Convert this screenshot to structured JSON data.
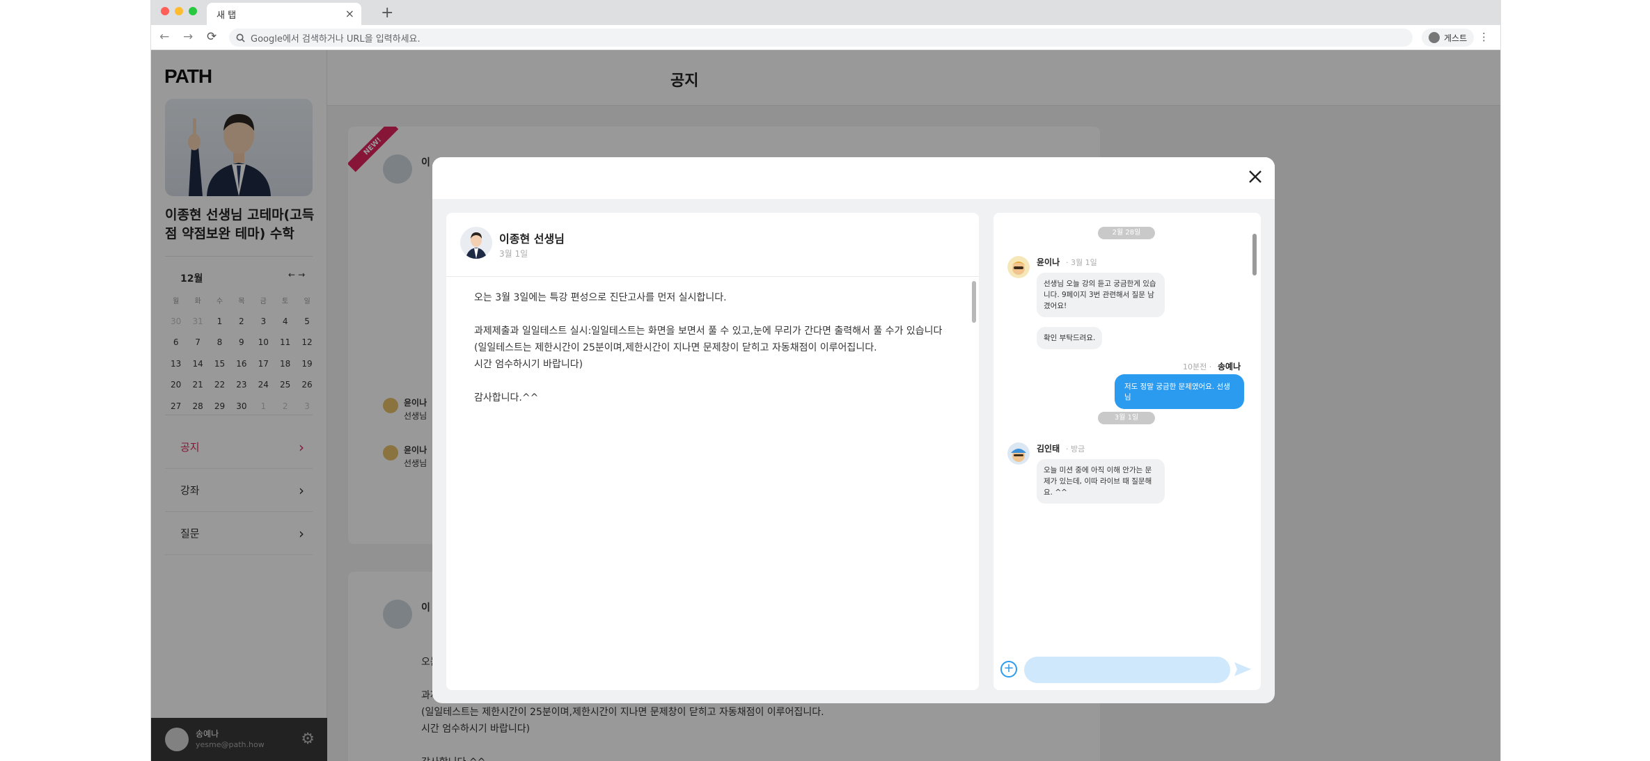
{
  "browser": {
    "tab_title": "새 탭",
    "tab_close": "×",
    "new_tab": "+",
    "omnibox_placeholder": "Google에서 검색하거나 URL을 입력하세요.",
    "profile_label": "게스트",
    "colors": {
      "red": "#ff5f57",
      "yellow": "#febc2e",
      "green": "#28c840"
    }
  },
  "sidebar": {
    "logo": "PATH",
    "course_title": "이종현 선생님 고테마(고득점 약점보완 테마) 수학",
    "calendar": {
      "month": "12월",
      "prev": "←",
      "next": "→",
      "weekdays": [
        "월",
        "화",
        "수",
        "목",
        "금",
        "토",
        "일"
      ],
      "weeks": [
        [
          {
            "d": "30",
            "dim": true
          },
          {
            "d": "31",
            "dim": true
          },
          {
            "d": "1"
          },
          {
            "d": "2"
          },
          {
            "d": "3"
          },
          {
            "d": "4"
          },
          {
            "d": "5"
          }
        ],
        [
          {
            "d": "6"
          },
          {
            "d": "7"
          },
          {
            "d": "8"
          },
          {
            "d": "9"
          },
          {
            "d": "10"
          },
          {
            "d": "11"
          },
          {
            "d": "12"
          }
        ],
        [
          {
            "d": "13"
          },
          {
            "d": "14"
          },
          {
            "d": "15"
          },
          {
            "d": "16"
          },
          {
            "d": "17"
          },
          {
            "d": "18"
          },
          {
            "d": "19"
          }
        ],
        [
          {
            "d": "20"
          },
          {
            "d": "21"
          },
          {
            "d": "22"
          },
          {
            "d": "23"
          },
          {
            "d": "24"
          },
          {
            "d": "25"
          },
          {
            "d": "26"
          }
        ],
        [
          {
            "d": "27"
          },
          {
            "d": "28"
          },
          {
            "d": "29"
          },
          {
            "d": "30"
          },
          {
            "d": "1",
            "dim": true
          },
          {
            "d": "2",
            "dim": true
          },
          {
            "d": "3",
            "dim": true
          }
        ]
      ]
    },
    "menu": [
      {
        "label": "공지",
        "active": true
      },
      {
        "label": "강좌",
        "active": false
      },
      {
        "label": "질문",
        "active": false
      }
    ],
    "user": {
      "name": "송예나",
      "email": "yesme@path.how"
    }
  },
  "main": {
    "page_title": "공지",
    "new_badge": "NEW!",
    "bg_post": {
      "author_initial": "이",
      "text_lines": [
        "오는 3월 3일에는 특강 편성으로 진단고사를 먼저 실시합니다.",
        "",
        "과제제출과 일일테스트 실시:일일테스트는 화면을 보면서 풀 수 있고,눈에 무리가 간다면 출력해서 풀 수가 있습니다",
        "(일일테스트는 제한시간이 25분이며,제한시간이 지나면 문제창이 닫히고 자동채점이 이루어집니다.",
        "시간 엄수하시기 바랍니다)",
        "",
        "감사합니다.^^"
      ],
      "comments": [
        {
          "name": "윤이나",
          "text": "선생님"
        },
        {
          "name": "윤이나",
          "text": "선생님"
        }
      ]
    }
  },
  "modal": {
    "close_label": "×",
    "notice": {
      "author": "이종현 선생님",
      "date": "3월 1일",
      "body": "오는 3월 3일에는 특강 편성으로 진단고사를 먼저 실시합니다.\n\n과제제출과 일일테스트 실시:일일테스트는 화면을 보면서 풀 수 있고,눈에 무리가 간다면 출력해서 풀 수가 있습니다\n(일일테스트는 제한시간이 25분이며,제한시간이 지나면 문제창이 닫히고 자동채점이 이루어집니다.\n시간 엄수하시기 바랍니다)\n\n감사합니다.^^"
    },
    "chat": {
      "date1": "2월 28일",
      "msg1": {
        "name": "윤이나",
        "time": "· 3월 1일",
        "text": "선생님 오늘 강의 듣고 궁금한게 있습니다. 9페이지 3번 관련해서 질문 남겼어요!"
      },
      "msg1b": {
        "text": "확인 부탁드려요."
      },
      "out": {
        "time": "10분전 ·",
        "name": "송예나",
        "text": "저도 정말 궁금한 문제였어요. 선생님"
      },
      "date2": "3월 1일",
      "msg2": {
        "name": "김인태",
        "time": "· 방금",
        "text": "오늘 미션 중에 아직 이해 안가는 문제가 있는데, 이따 라이브 때 질문해요. ^^"
      },
      "input_placeholder": "",
      "accent": "#2b9bf0"
    }
  }
}
